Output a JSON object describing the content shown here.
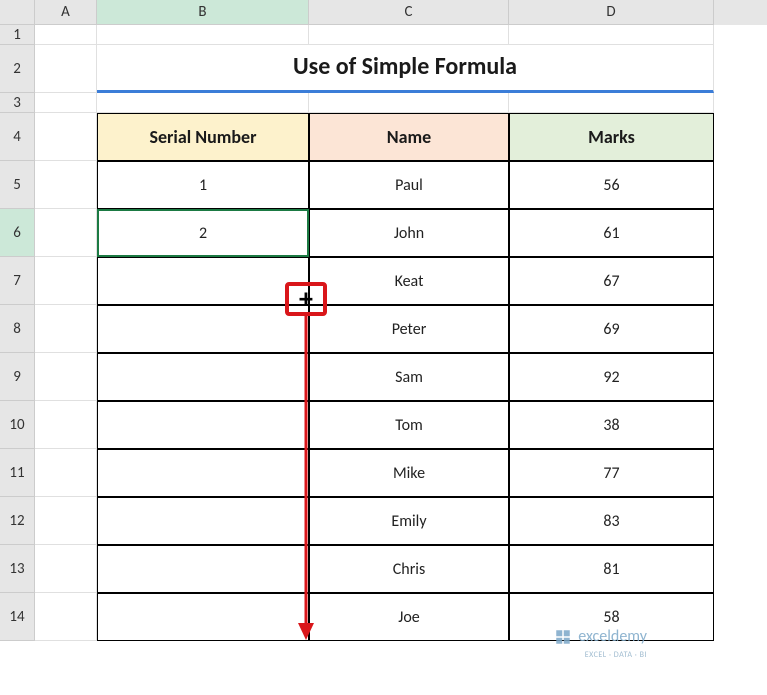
{
  "columns": [
    "A",
    "B",
    "C",
    "D"
  ],
  "rows": [
    "1",
    "2",
    "3",
    "4",
    "5",
    "6",
    "7",
    "8",
    "9",
    "10",
    "11",
    "12",
    "13",
    "14"
  ],
  "title": "Use of Simple Formula",
  "headers": {
    "serial": "Serial Number",
    "name": "Name",
    "marks": "Marks"
  },
  "chart_data": {
    "type": "table",
    "title": "Use of Simple Formula",
    "columns": [
      "Serial Number",
      "Name",
      "Marks"
    ],
    "rows": [
      {
        "serial": "1",
        "name": "Paul",
        "marks": "56"
      },
      {
        "serial": "2",
        "name": "John",
        "marks": "61"
      },
      {
        "serial": "",
        "name": "Keat",
        "marks": "67"
      },
      {
        "serial": "",
        "name": "Peter",
        "marks": "69"
      },
      {
        "serial": "",
        "name": "Sam",
        "marks": "92"
      },
      {
        "serial": "",
        "name": "Tom",
        "marks": "38"
      },
      {
        "serial": "",
        "name": "Mike",
        "marks": "77"
      },
      {
        "serial": "",
        "name": "Emily",
        "marks": "83"
      },
      {
        "serial": "",
        "name": "Chris",
        "marks": "81"
      },
      {
        "serial": "",
        "name": "Joe",
        "marks": "58"
      }
    ]
  },
  "active_cell": "B6",
  "fill_cursor": "+",
  "watermark": {
    "name": "exceldemy",
    "sub": "EXCEL · DATA · BI"
  }
}
